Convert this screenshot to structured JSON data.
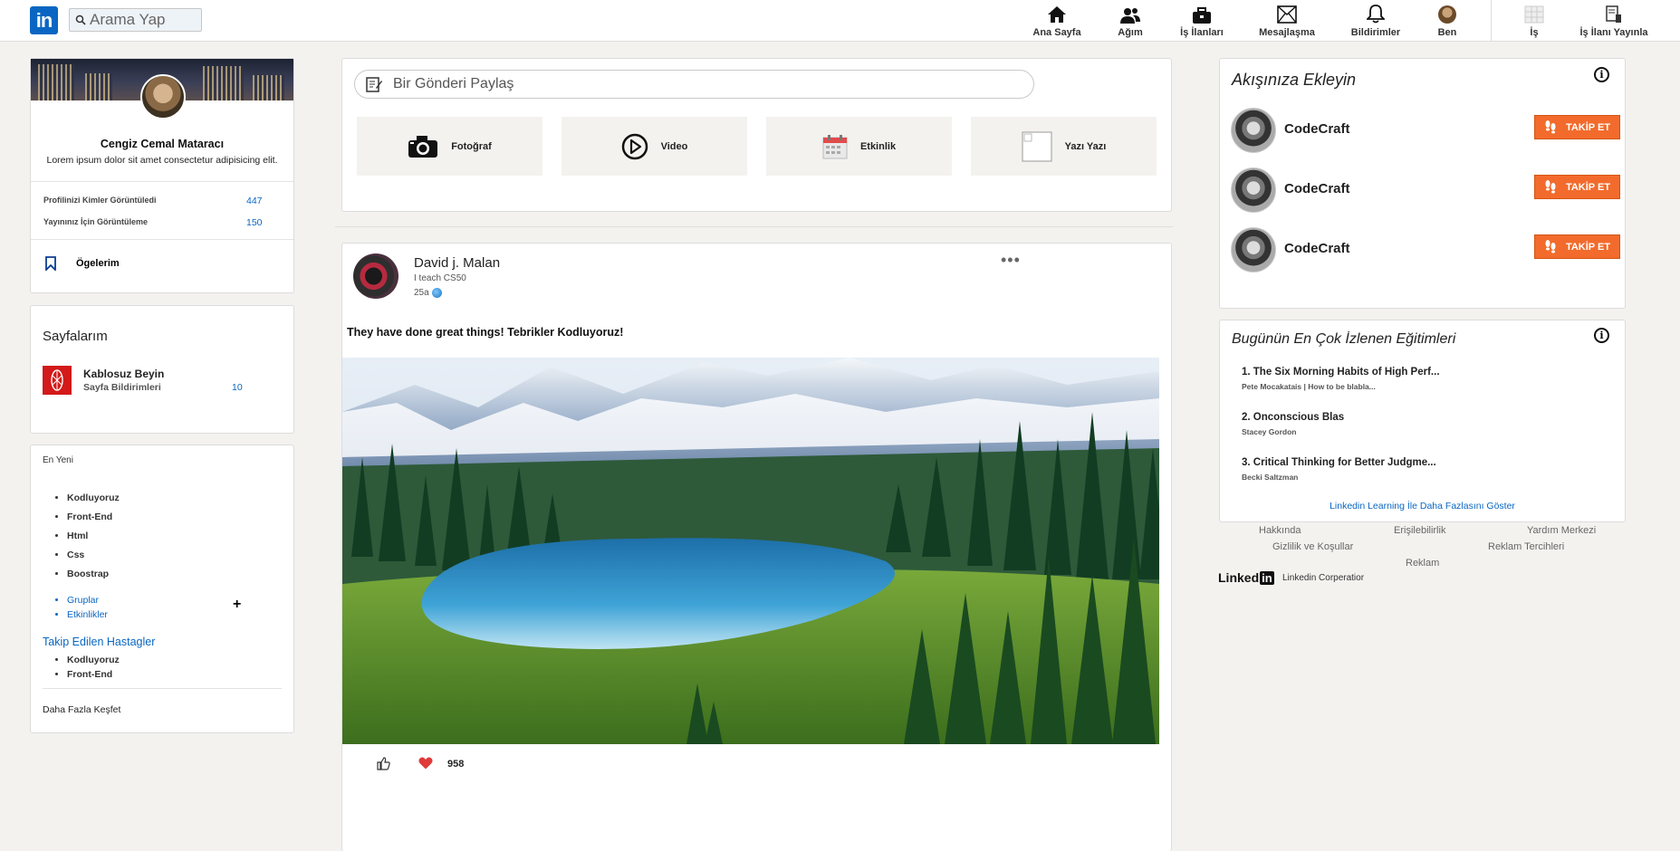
{
  "nav": {
    "logo": "in",
    "search_placeholder": "Arama Yap",
    "items": [
      {
        "label": "Ana Sayfa"
      },
      {
        "label": "Ağım"
      },
      {
        "label": "İş İlanları"
      },
      {
        "label": "Mesajlaşma"
      },
      {
        "label": "Bildirimler"
      },
      {
        "label": "Ben"
      },
      {
        "label": "İş"
      },
      {
        "label": "İş İlanı Yayınla"
      }
    ]
  },
  "profile": {
    "name": "Cengiz Cemal Mataracı",
    "description": "Lorem ipsum dolor sit amet consectetur adipisicing elit.",
    "stats": [
      {
        "label": "Profilinizi Kimler Görüntüledi",
        "value": "447"
      },
      {
        "label": "Yayınınız İçin Görüntüleme",
        "value": "150"
      }
    ],
    "saved_label": "Ögelerim"
  },
  "pages": {
    "title": "Sayfalarım",
    "item": {
      "name": "Kablosuz Beyin",
      "sub": "Sayfa Bildirimleri",
      "count": "10"
    }
  },
  "recent": {
    "heading": "En Yeni",
    "tags": [
      "Kodluyoruz",
      "Front-End",
      "Html",
      "Css",
      "Boostrap"
    ],
    "links": [
      "Gruplar",
      "Etkinlikler"
    ],
    "followed_heading": "Takip Edilen Hastagler",
    "followed_tags": [
      "Kodluyoruz",
      "Front-End"
    ],
    "explore_label": "Daha Fazla Keşfet"
  },
  "share": {
    "placeholder": "Bir Gönderi Paylaş",
    "buttons": [
      {
        "label": "Fotoğraf",
        "icon": "camera-icon"
      },
      {
        "label": "Video",
        "icon": "play-icon"
      },
      {
        "label": "Etkinlik",
        "icon": "calendar-icon"
      },
      {
        "label": "Yazı Yazı",
        "icon": "broken-image-icon"
      }
    ]
  },
  "post": {
    "author": "David j. Malan",
    "subtitle": "I teach CS50",
    "time": "25a",
    "text": "They have done great things! Tebrikler Kodluyoruz!",
    "reactions": "958",
    "like_color": "#e03a3a"
  },
  "follow": {
    "title": "Akışınıza Ekleyin",
    "items": [
      {
        "name": "CodeCraft",
        "button": "TAKİP ET"
      },
      {
        "name": "CodeCraft",
        "button": "TAKİP ET"
      },
      {
        "name": "CodeCraft",
        "button": "TAKİP ET"
      }
    ],
    "button_color": "#f26b2c"
  },
  "courses": {
    "title": "Bugünün En Çok İzlenen Eğitimleri",
    "items": [
      {
        "title": "1. The Six Morning Habits of High Perf...",
        "author": "Pete Mocakatais | How to be blabla..."
      },
      {
        "title": "2. Onconscious Blas",
        "author": "Stacey Gordon"
      },
      {
        "title": "3. Critical Thinking for Better Judgme...",
        "author": "Becki Saltzman"
      }
    ],
    "more_link": "Linkedin Learning İle Daha Fazlasını Göster"
  },
  "footer": {
    "links": [
      "Hakkında",
      "Erişilebilirlik",
      "Yardım Merkezi",
      "Gizlilik ve Koşullar",
      "Reklam Tercihleri",
      "Reklam"
    ],
    "logo_text": "Linked",
    "logo_box": "in",
    "corp": "Linkedin Corperatior"
  }
}
